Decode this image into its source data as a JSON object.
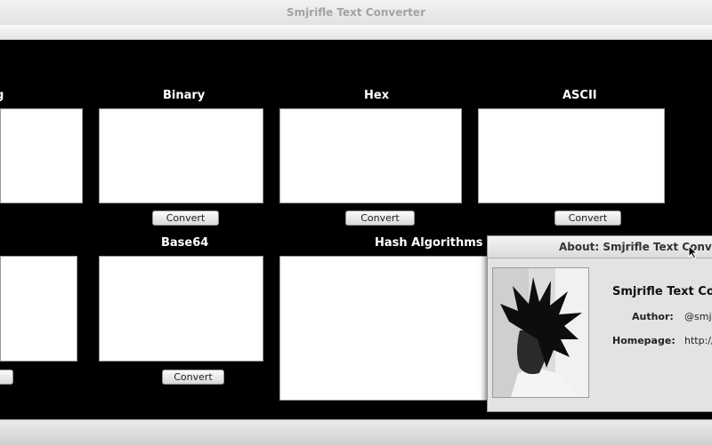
{
  "window": {
    "title": "Smjrifle Text Converter"
  },
  "converters": {
    "row1": [
      {
        "label": "g",
        "button": ""
      },
      {
        "label": "Binary",
        "button": "Convert"
      },
      {
        "label": "Hex",
        "button": "Convert"
      },
      {
        "label": "ASCII",
        "button": "Convert"
      }
    ],
    "row2": [
      {
        "label": "",
        "button": ""
      },
      {
        "label": "Base64",
        "button": "Convert"
      },
      {
        "label": "Hash Algorithms",
        "button": ""
      }
    ]
  },
  "about_dialog": {
    "title": "About: Smjrifle Text Converter",
    "app_name": "Smjrifle Text Co",
    "author_label": "Author:",
    "author_value": "@smjr",
    "homepage_label": "Homepage:",
    "homepage_value": "http://"
  },
  "colors": {
    "canvas": "#000000",
    "textarea": "#ffffff",
    "label": "#ffffff"
  }
}
